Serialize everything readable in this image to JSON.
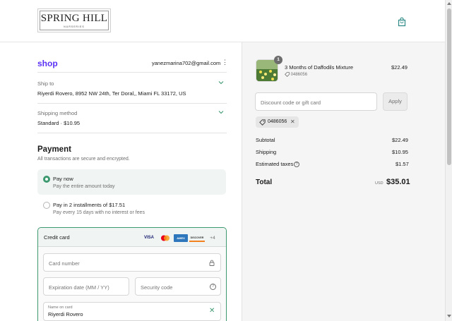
{
  "header": {
    "logo_name": "SPRING HILL",
    "logo_sub": "NURSERIES",
    "bag_icon": "shopping-bag-icon"
  },
  "account": {
    "shop_label": "shop",
    "email": "yanezmarina702@gmail.com",
    "menu_icon": "kebab-icon"
  },
  "ship_to": {
    "label": "Ship to",
    "value": "Riyerdi Rovero, 8952 NW 24th, Ter Doral,, Miami FL 33172, US"
  },
  "shipping_method": {
    "label": "Shipping method",
    "value": "Standard · $10.95"
  },
  "payment": {
    "title": "Payment",
    "subtitle": "All transactions are secure and encrypted.",
    "options": [
      {
        "title": "Pay now",
        "subtitle": "Pay the entire amount today",
        "selected": true
      },
      {
        "title": "Pay in 2 installments of $17.51",
        "subtitle": "Pay every 15 days with no interest or fees",
        "selected": false
      }
    ],
    "credit_card": {
      "title": "Credit card",
      "logos": [
        "VISA",
        "MC",
        "AMEX",
        "DISCOVER"
      ],
      "more": "+4",
      "card_number_placeholder": "Card number",
      "expiration_placeholder": "Expiration date (MM / YY)",
      "security_placeholder": "Security code",
      "name_label": "Name on card",
      "name_value": "Riyerdi Rovero"
    }
  },
  "order": {
    "item": {
      "quantity": "1",
      "name": "3 Months of Daffodils Mixture",
      "code": "0486056",
      "price": "$22.49"
    },
    "discount": {
      "placeholder": "Discount code or gift card",
      "apply_label": "Apply",
      "applied_code": "0486056"
    },
    "summary": {
      "subtotal_label": "Subtotal",
      "subtotal_value": "$22.49",
      "shipping_label": "Shipping",
      "shipping_value": "$10.95",
      "taxes_label": "Estimated taxes",
      "taxes_value": "$1.57",
      "total_label": "Total",
      "currency": "USD",
      "total_value": "$35.01"
    }
  },
  "colors": {
    "shop_brand": "#5a31f4",
    "accent_green": "#3d9970"
  }
}
